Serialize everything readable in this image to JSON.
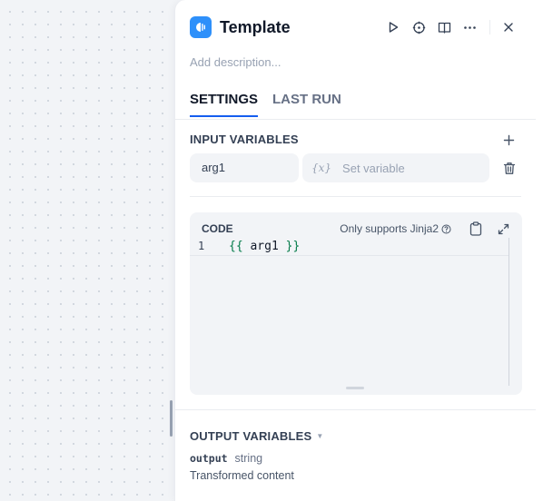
{
  "panel": {
    "title": "Template",
    "description_placeholder": "Add description...",
    "icon": "template-node-icon",
    "accent_color": "#155eef",
    "node_icon_color": "#2e90fa"
  },
  "header_actions": [
    {
      "name": "run-icon"
    },
    {
      "name": "help-crosshair-icon"
    },
    {
      "name": "panel-toggle-icon"
    },
    {
      "name": "more-options-icon"
    },
    {
      "name": "close-icon"
    }
  ],
  "tabs": [
    {
      "label": "SETTINGS",
      "active": true
    },
    {
      "label": "LAST RUN",
      "active": false
    }
  ],
  "input_variables": {
    "title": "INPUT VARIABLES",
    "items": [
      {
        "name": "arg1",
        "value_prefix": "{x}",
        "value_placeholder": "Set variable"
      }
    ]
  },
  "code": {
    "label": "CODE",
    "hint": "Only supports Jinja2",
    "lines": [
      {
        "number": "1",
        "open": "{{",
        "expr": "arg1",
        "close": "}}"
      }
    ]
  },
  "output_variables": {
    "title": "OUTPUT VARIABLES",
    "items": [
      {
        "name": "output",
        "type": "string",
        "description": "Transformed content"
      }
    ]
  }
}
